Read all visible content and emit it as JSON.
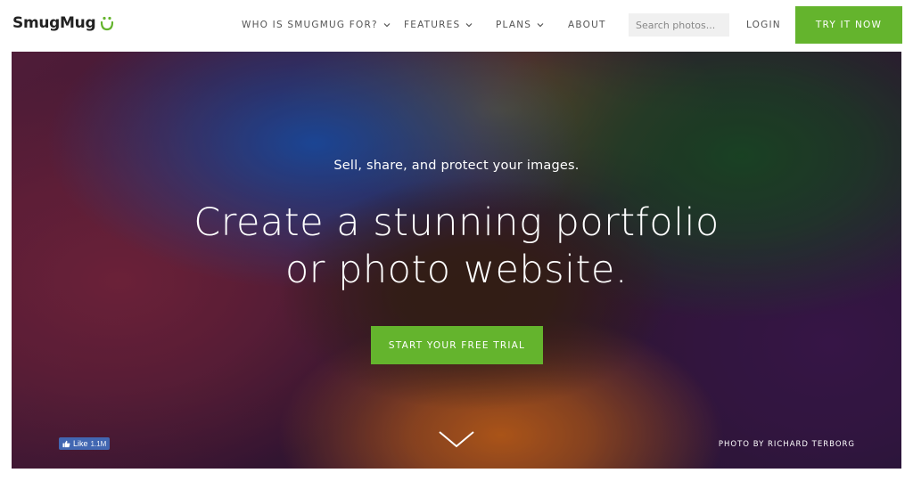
{
  "brand": {
    "name": "SmugMug",
    "accent": "#64b42d"
  },
  "nav": {
    "items": [
      {
        "label": "WHO IS SMUGMUG FOR?",
        "has_dropdown": true
      },
      {
        "label": "FEATURES",
        "has_dropdown": true
      },
      {
        "label": "PLANS",
        "has_dropdown": true
      },
      {
        "label": "ABOUT",
        "has_dropdown": false
      }
    ],
    "search_placeholder": "Search photos...",
    "login": "LOGIN",
    "try_button": "TRY IT NOW"
  },
  "hero": {
    "subtitle": "Sell, share, and protect your images.",
    "headline_line1": "Create a stunning portfolio",
    "headline_line2": "or photo website.",
    "cta": "START YOUR FREE TRIAL",
    "facebook": {
      "label": "Like",
      "count": "1.1M"
    },
    "photo_credit": "PHOTO BY RICHARD TERBORG"
  }
}
